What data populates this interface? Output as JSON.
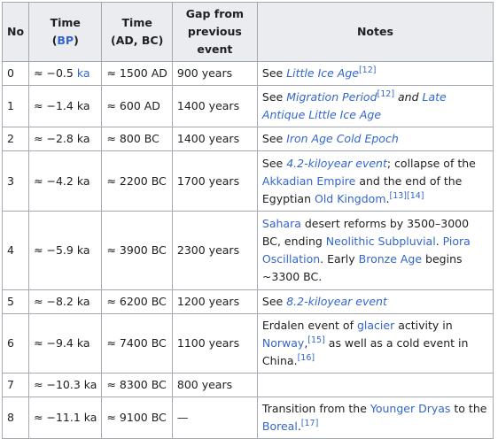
{
  "headers": {
    "no": "No",
    "time_bp": "Time",
    "bp_link": "BP",
    "time_ad": "Time",
    "time_ad_sub": "(AD, BC)",
    "gap_line1": "Gap from",
    "gap_line2": "previous",
    "gap_line3": "event",
    "notes": "Notes"
  },
  "rows": [
    {
      "no": "0",
      "bp_pre": "≈ −0.5 ",
      "bp_link": "ka",
      "ad": "≈ 1500 AD",
      "gap": "900 years",
      "notes": [
        {
          "t": "See "
        },
        {
          "i": "Little Ice Age",
          "link": true
        },
        {
          "sup": "[12]"
        }
      ]
    },
    {
      "no": "1",
      "bp_pre": "≈ −1.4 ka",
      "bp_link": "",
      "ad": "≈ 600 AD",
      "gap": "1400 years",
      "notes": [
        {
          "t": "See "
        },
        {
          "i": "Migration Period",
          "link": true
        },
        {
          "sup": "[12]"
        },
        {
          "it": " and "
        },
        {
          "i": "Late Antique Little Ice Age",
          "link": true
        }
      ]
    },
    {
      "no": "2",
      "bp_pre": "≈ −2.8 ka",
      "bp_link": "",
      "ad": "≈ 800 BC",
      "gap": "1400 years",
      "notes": [
        {
          "t": "See "
        },
        {
          "i": "Iron Age Cold Epoch",
          "link": true
        }
      ]
    },
    {
      "no": "3",
      "bp_pre": "≈ −4.2 ka",
      "bp_link": "",
      "ad": "≈ 2200 BC",
      "gap": "1700 years",
      "notes": [
        {
          "t": "See "
        },
        {
          "i": "4.2-kiloyear event",
          "link": true
        },
        {
          "t": "; collapse of the "
        },
        {
          "a": "Akkadian Empire"
        },
        {
          "t": " and the end of the Egyptian "
        },
        {
          "a": "Old Kingdom"
        },
        {
          "t": "."
        },
        {
          "sup": "[13][14]"
        }
      ]
    },
    {
      "no": "4",
      "bp_pre": "≈ −5.9 ka",
      "bp_link": "",
      "ad": "≈ 3900 BC",
      "gap": "2300 years",
      "notes": [
        {
          "a": "Sahara"
        },
        {
          "t": " desert reforms by 3500–3000 BC, ending "
        },
        {
          "a": "Neolithic Subpluvial"
        },
        {
          "t": ". "
        },
        {
          "a": "Piora Oscillation"
        },
        {
          "t": ". Early "
        },
        {
          "a": "Bronze Age"
        },
        {
          "t": " begins ~3300 BC."
        }
      ]
    },
    {
      "no": "5",
      "bp_pre": "≈ −8.2 ka",
      "bp_link": "",
      "ad": "≈ 6200 BC",
      "gap": "1200 years",
      "notes": [
        {
          "t": "See "
        },
        {
          "i": "8.2-kiloyear event",
          "link": true
        }
      ]
    },
    {
      "no": "6",
      "bp_pre": "≈ −9.4 ka",
      "bp_link": "",
      "ad": "≈ 7400 BC",
      "gap": "1100 years",
      "notes": [
        {
          "t": "Erdalen event of "
        },
        {
          "a": "glacier"
        },
        {
          "t": " activity in "
        },
        {
          "a": "Norway"
        },
        {
          "t": ","
        },
        {
          "sup": "[15]"
        },
        {
          "t": " as well as a cold event in China."
        },
        {
          "sup": "[16]"
        }
      ]
    },
    {
      "no": "7",
      "bp_pre": "≈ −10.3 ka",
      "bp_link": "",
      "ad": "≈ 8300 BC",
      "gap": "800 years",
      "notes": []
    },
    {
      "no": "8",
      "bp_pre": "≈ −11.1 ka",
      "bp_link": "",
      "ad": "≈ 9100 BC",
      "gap": "—",
      "notes": [
        {
          "t": "Transition from the "
        },
        {
          "a": "Younger Dryas"
        },
        {
          "t": " to the "
        },
        {
          "a": "Boreal"
        },
        {
          "t": "."
        },
        {
          "sup": "[17]"
        }
      ]
    }
  ],
  "colors": {
    "link": "#3366cc",
    "text": "#202122",
    "header_bg": "#eaecf0",
    "border": "#a2a9b1"
  }
}
